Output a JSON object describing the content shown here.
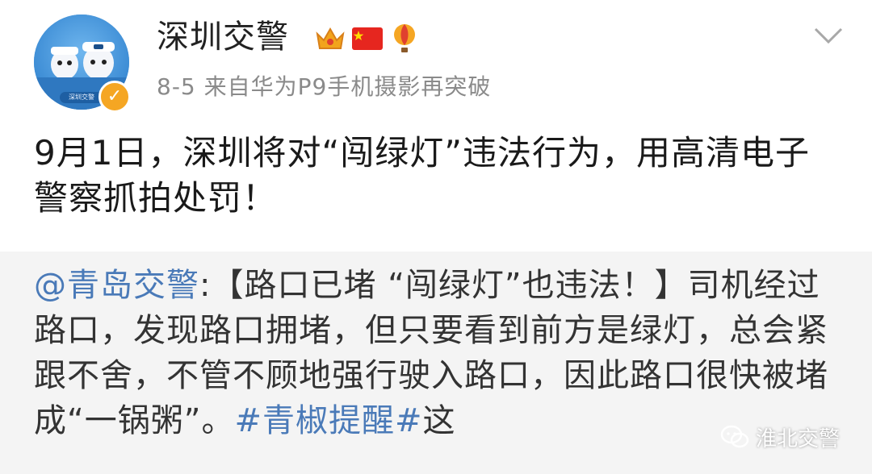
{
  "post": {
    "author": "深圳交警",
    "badges": [
      "crown-icon",
      "china-flag-icon",
      "hot-air-balloon-icon"
    ],
    "meta": "8-5  来自华为P9手机摄影再突破",
    "content": "9月1日，深圳将对“闯绿灯”违法行为，用高清电子警察抓拍处罚！",
    "avatar_sign": "深圳交警"
  },
  "repost": {
    "mention": "@青岛交警",
    "text": ":【路口已堵 “闯绿灯”也违法！】司机经过路口，发现路口拥堵，但只要看到前方是绿灯，总会紧跟不舍，不管不顾地强行驶入路口，因此路口很快被堵成“一锅粥”。",
    "topic": "#青椒提醒#",
    "tail": "这"
  },
  "watermark": {
    "text": "淮北交警"
  },
  "colors": {
    "link": "#4a7ab8",
    "meta": "#8a8a8a",
    "repost_bg": "#f4f4f4"
  }
}
